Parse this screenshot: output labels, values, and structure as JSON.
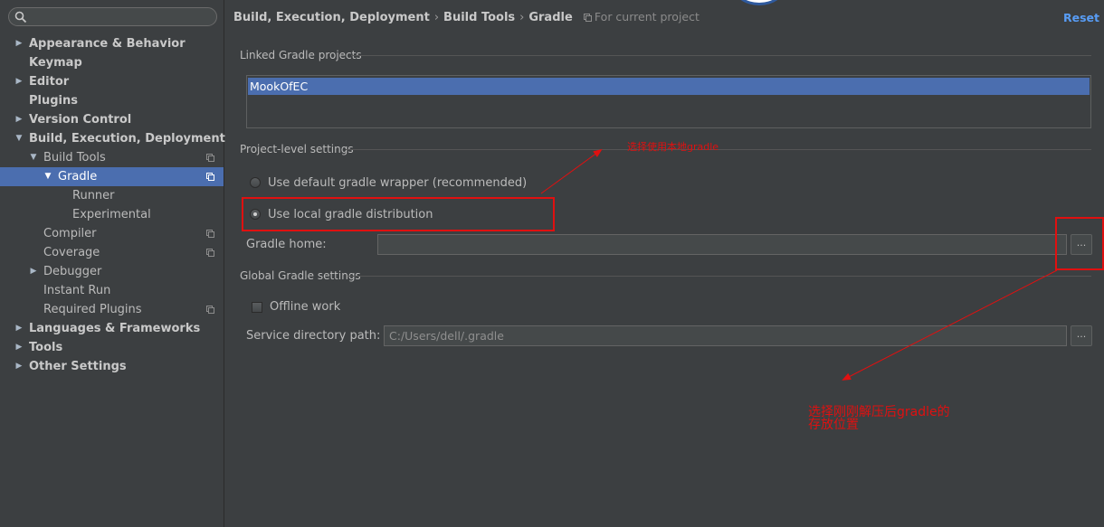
{
  "sidebar": {
    "search_placeholder": "",
    "items": [
      {
        "label": "Appearance & Behavior",
        "arrow": "▶"
      },
      {
        "label": "Keymap"
      },
      {
        "label": "Editor",
        "arrow": "▶"
      },
      {
        "label": "Plugins"
      },
      {
        "label": "Version Control",
        "arrow": "▶"
      },
      {
        "label": "Build, Execution, Deployment",
        "arrow": "▼"
      },
      {
        "label": "Build Tools",
        "arrow": "▼"
      },
      {
        "label": "Gradle",
        "arrow": "▼"
      },
      {
        "label": "Runner"
      },
      {
        "label": "Experimental"
      },
      {
        "label": "Compiler"
      },
      {
        "label": "Coverage"
      },
      {
        "label": "Debugger",
        "arrow": "▶"
      },
      {
        "label": "Instant Run"
      },
      {
        "label": "Required Plugins"
      },
      {
        "label": "Languages & Frameworks",
        "arrow": "▶"
      },
      {
        "label": "Tools",
        "arrow": "▶"
      },
      {
        "label": "Other Settings",
        "arrow": "▶"
      }
    ]
  },
  "header": {
    "crumbs": [
      "Build, Execution, Deployment",
      "Build Tools",
      "Gradle"
    ],
    "separator": "›",
    "scope": "For current project",
    "reset": "Reset"
  },
  "linked": {
    "title": "Linked Gradle projects",
    "projects": [
      "MookOfEC"
    ]
  },
  "project_level": {
    "title": "Project-level settings",
    "option_default": "Use default gradle wrapper (recommended)",
    "option_local": "Use local gradle distribution",
    "selected": "local",
    "gradle_home_label": "Gradle home:",
    "gradle_home_value": "",
    "browse": "..."
  },
  "global": {
    "title": "Global Gradle settings",
    "offline_label": "Offline work",
    "offline_checked": false,
    "service_dir_label": "Service directory path:",
    "service_dir_value": "C:/Users/dell/.gradle",
    "browse": "..."
  },
  "annotations": {
    "note1": "选择使用本地gradle",
    "note2_line1": "选择刚刚解压后gradle的",
    "note2_line2": "存放位置"
  },
  "colors": {
    "background": "#3c3f41",
    "selection": "#4b6eaf",
    "link": "#589df6",
    "annotation": "#e01010"
  }
}
